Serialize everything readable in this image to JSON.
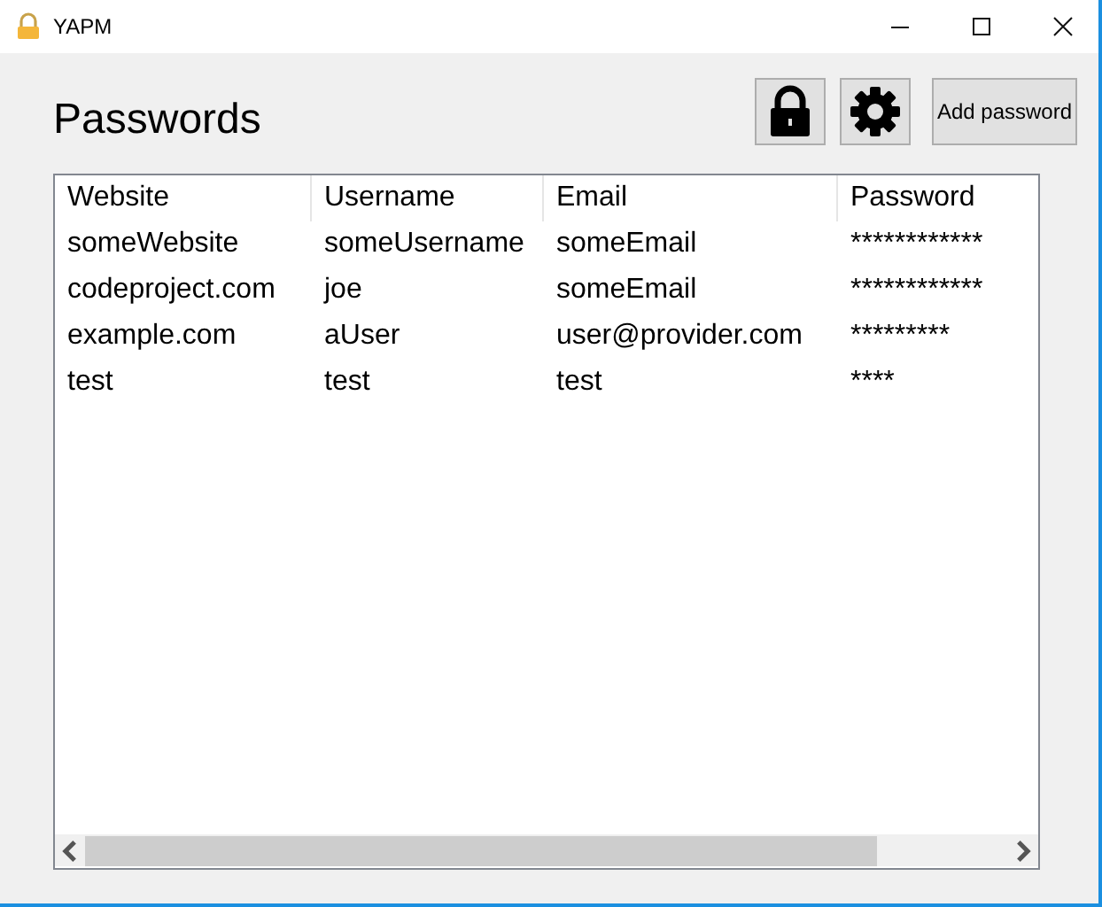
{
  "window": {
    "title": "YAPM"
  },
  "heading": "Passwords",
  "toolbar": {
    "add_button": "Add password"
  },
  "table": {
    "columns": [
      "Website",
      "Username",
      "Email",
      "Password"
    ],
    "rows": [
      [
        "someWebsite",
        "someUsername",
        "someEmail",
        "************"
      ],
      [
        "codeproject.com",
        "joe",
        "someEmail",
        "************"
      ],
      [
        "example.com",
        "aUser",
        "user@provider.com",
        "*********"
      ],
      [
        "test",
        "test",
        "test",
        "****"
      ]
    ]
  }
}
